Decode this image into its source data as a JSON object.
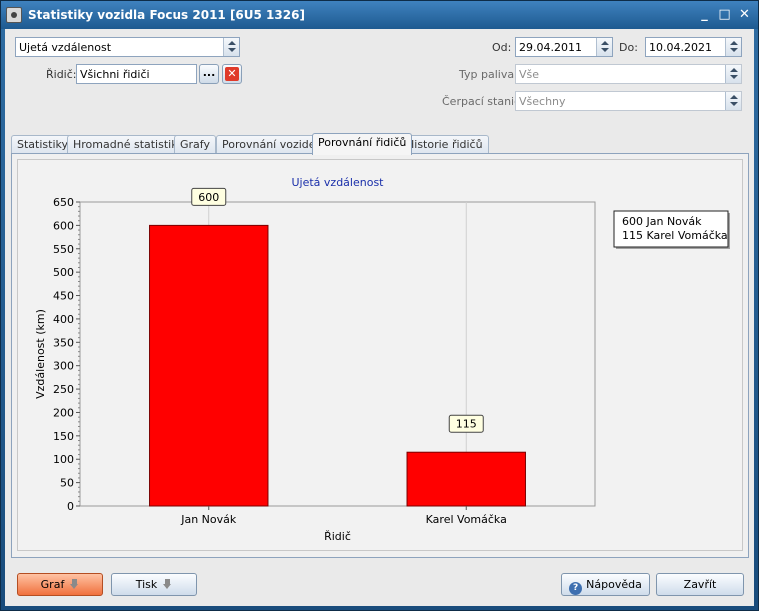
{
  "window": {
    "title": "Statistiky vozidla Focus 2011 [6U5 1326]",
    "controls": [
      "_",
      "□",
      "✕"
    ]
  },
  "filters": {
    "metric": "Ujetá vzdálenost",
    "driver_label": "Řidič:",
    "driver_value": "Všichni řidiči",
    "browse_label": "...",
    "clear_label": "✕",
    "from_label": "Od:",
    "from_value": "29.04.2011",
    "to_label": "Do:",
    "to_value": "10.04.2021",
    "fuel_label": "Typ paliva:",
    "fuel_value": "Vše",
    "station_label": "Čerpací stanice",
    "station_value": "Všechny"
  },
  "tabs": [
    {
      "label": "Statistiky"
    },
    {
      "label": "Hromadné statistiky"
    },
    {
      "label": "Grafy"
    },
    {
      "label": "Porovnání vozidel"
    },
    {
      "label": "Porovnání řidičů",
      "active": true
    },
    {
      "label": "Historie řidičů"
    }
  ],
  "chart_data": {
    "type": "bar",
    "title": "Ujetá vzdálenost",
    "xlabel": "Řidič",
    "ylabel": "Vzdálenost (km)",
    "categories": [
      "Jan Novák",
      "Karel Vomáčka"
    ],
    "values": [
      600,
      115
    ],
    "data_labels": [
      "600",
      "115"
    ],
    "ylim": [
      0,
      650
    ],
    "yticks": [
      0,
      50,
      100,
      150,
      200,
      250,
      300,
      350,
      400,
      450,
      500,
      550,
      600,
      650
    ],
    "bar_color": "#ff0000",
    "grid": true,
    "legend_position": "top-right",
    "legend": [
      "600 Jan Novák",
      "115 Karel Vomáčka"
    ]
  },
  "buttons": {
    "graph": "Graf",
    "print": "Tisk",
    "help": "Nápověda",
    "close": "Zavřít"
  }
}
